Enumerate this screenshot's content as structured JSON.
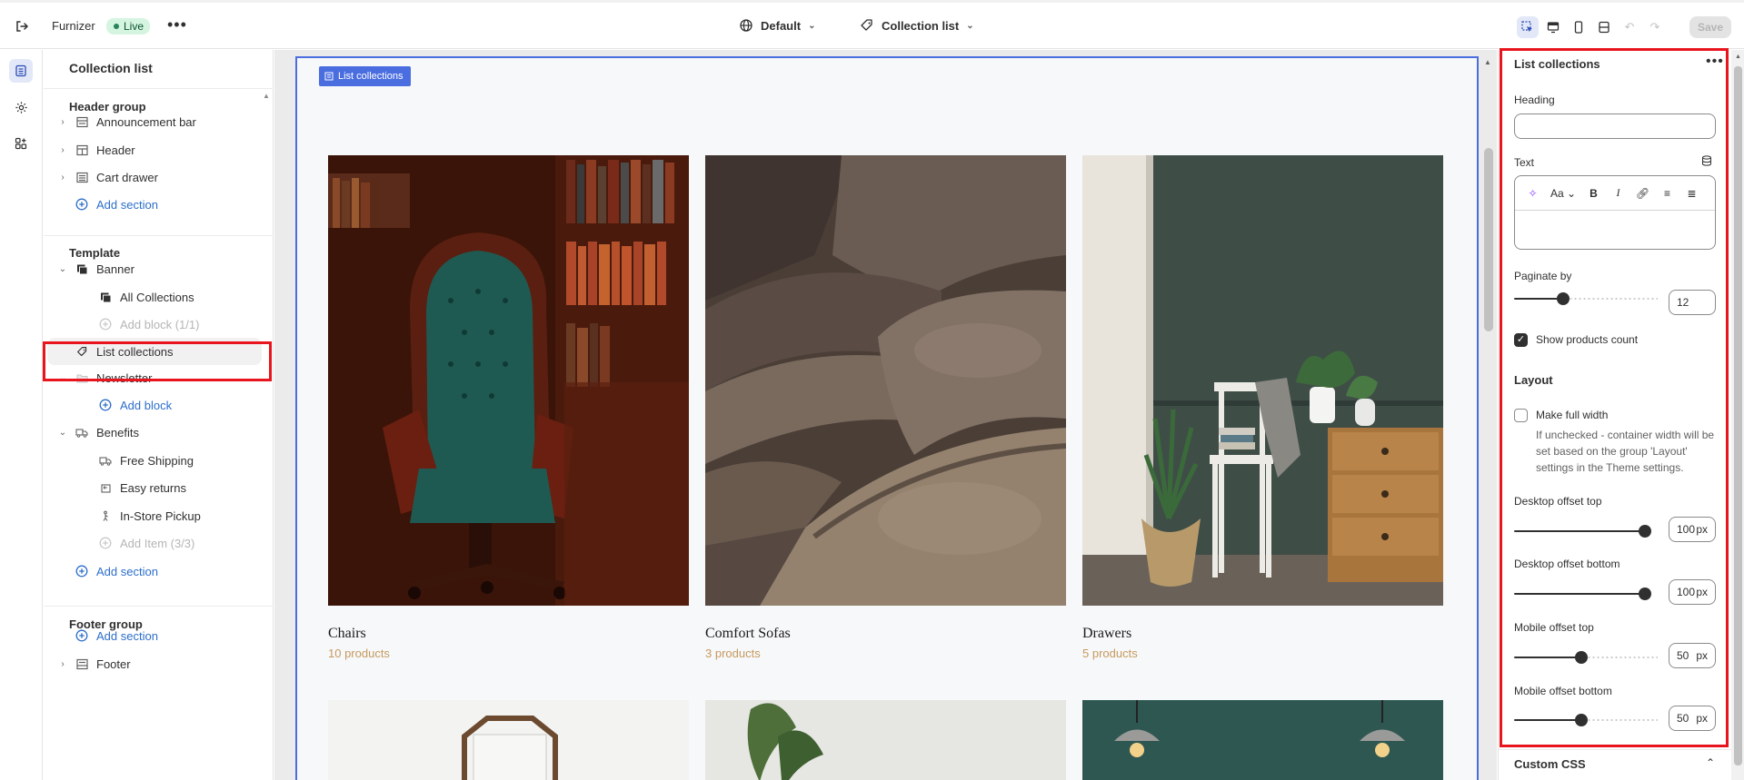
{
  "topbar": {
    "store_name": "Furnizer",
    "status": "Live",
    "theme_label": "Default",
    "page_label": "Collection list",
    "save_label": "Save"
  },
  "sidebar": {
    "title": "Collection list",
    "header_group": {
      "title": "Header group",
      "items": [
        "Announcement bar",
        "Header",
        "Cart drawer"
      ],
      "add_label": "Add section"
    },
    "template": {
      "title": "Template",
      "banner": "Banner",
      "banner_children": [
        "All Collections",
        "Add block (1/1)"
      ],
      "list_collections": "List collections",
      "newsletter": "Newsletter",
      "newsletter_add": "Add block",
      "benefits": "Benefits",
      "benefit_items": [
        "Free Shipping",
        "Easy returns",
        "In-Store Pickup",
        "Add Item (3/3)"
      ],
      "add_label": "Add section"
    },
    "footer_group": {
      "title": "Footer group",
      "add_label": "Add section",
      "footer": "Footer"
    }
  },
  "preview": {
    "tag": "List collections",
    "collections": [
      {
        "name": "Chairs",
        "count": "10 products"
      },
      {
        "name": "Comfort Sofas",
        "count": "3 products"
      },
      {
        "name": "Drawers",
        "count": "5 products"
      }
    ]
  },
  "panel": {
    "title": "List collections",
    "heading_label": "Heading",
    "heading_value": "",
    "text_label": "Text",
    "paginate_label": "Paginate by",
    "paginate_value": "12",
    "paginate_fraction": 0.2,
    "show_count_label": "Show products count",
    "show_count_checked": true,
    "layout_title": "Layout",
    "full_width_label": "Make full width",
    "full_width_checked": false,
    "full_width_help": "If unchecked - container width will be set based on the group 'Layout' settings in the Theme settings.",
    "desktop_top_label": "Desktop offset top",
    "desktop_top_value": "100",
    "desktop_bottom_label": "Desktop offset bottom",
    "desktop_bottom_value": "100",
    "mobile_top_label": "Mobile offset top",
    "mobile_top_value": "50",
    "mobile_bottom_label": "Mobile offset bottom",
    "mobile_bottom_value": "50",
    "unit": "px",
    "custom_css_label": "Custom CSS"
  },
  "colors": {
    "accent": "#2c6ecb",
    "selection_outline": "#4a6ee0",
    "highlight_red": "#e8141e",
    "product_count": "#c69a5e"
  }
}
